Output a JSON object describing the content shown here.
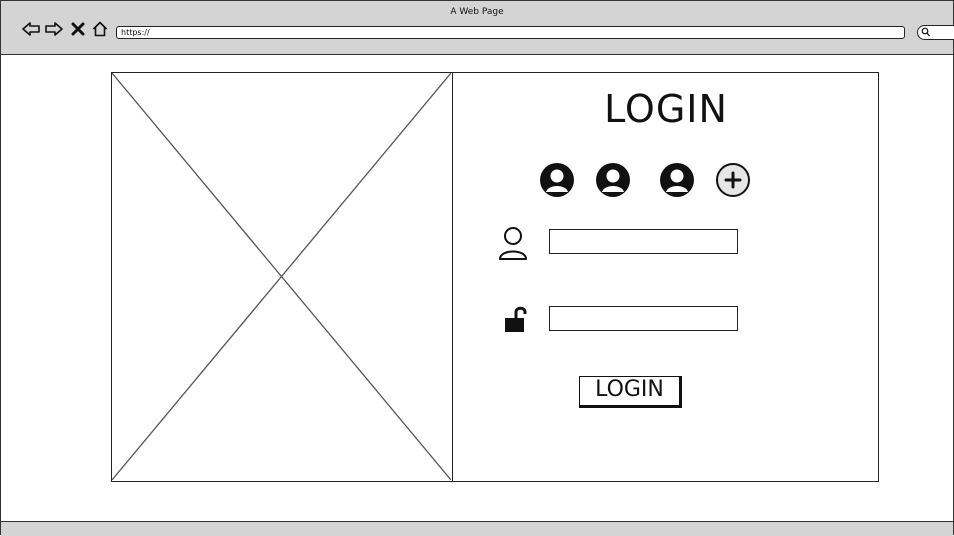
{
  "browser": {
    "title": "A Web Page",
    "url": "https://",
    "icons": {
      "back": "arrow-left-icon",
      "forward": "arrow-right-icon",
      "close": "close-icon",
      "home": "home-icon",
      "search": "search-icon"
    }
  },
  "main": {
    "image_placeholder": "image-placeholder",
    "login": {
      "title": "LOGIN",
      "avatars": [
        {
          "icon": "user-avatar-icon"
        },
        {
          "icon": "user-avatar-icon"
        },
        {
          "icon": "user-avatar-icon"
        },
        {
          "icon": "add-account-icon"
        }
      ],
      "username_icon": "user-icon",
      "username_value": "",
      "password_icon": "unlock-icon",
      "password_value": "",
      "button_label": "LOGIN"
    }
  }
}
